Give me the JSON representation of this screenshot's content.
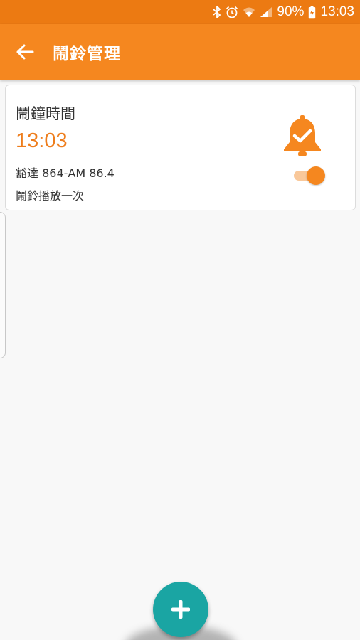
{
  "status_bar": {
    "battery_percent": "90%",
    "time": "13:03",
    "icons": [
      "bluetooth-icon",
      "alarm-clock-icon",
      "wifi-icon",
      "signal-icon",
      "battery-charging-icon"
    ]
  },
  "app_bar": {
    "title": "鬧鈴管理",
    "back_icon": "arrow-left-icon"
  },
  "alarm": {
    "title": "鬧鐘時間",
    "time": "13:03",
    "station": "豁達 864-AM 86.4",
    "repeat": "鬧鈴播放一次",
    "enabled": true,
    "icon": "bell-check-icon"
  },
  "fab": {
    "icon": "plus-icon"
  },
  "colors": {
    "status_bar": "#ec7a12",
    "app_bar": "#f5871f",
    "accent": "#ee7d1c",
    "fab": "#1aa5a3"
  }
}
